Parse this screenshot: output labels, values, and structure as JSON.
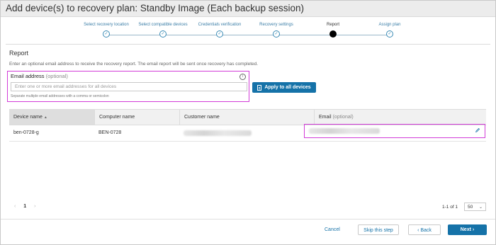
{
  "window": {
    "title": "Add device(s) to recovery plan: Standby Image (Each backup session)"
  },
  "stepper": {
    "steps": [
      {
        "label": "Select recovery location",
        "state": "done"
      },
      {
        "label": "Select compatible devices",
        "state": "done"
      },
      {
        "label": "Credentials verification",
        "state": "done"
      },
      {
        "label": "Recovery settings",
        "state": "done"
      },
      {
        "label": "Report",
        "state": "current"
      },
      {
        "label": "Assign plan",
        "state": "pending"
      }
    ]
  },
  "report": {
    "heading": "Report",
    "description": "Enter an optional email address to receive the recovery report. The email report will be sent once recovery has completed.",
    "email_label": "Email address",
    "email_optional": "(optional)",
    "email_value": "",
    "email_placeholder": "Enter one or more email addresses for all devices",
    "email_hint": "Separate multiple email addresses with a comma or semicolon",
    "apply_label": "Apply to all devices"
  },
  "table": {
    "columns": {
      "device_name": "Device name",
      "computer_name": "Computer name",
      "customer_name": "Customer name",
      "email": "Email",
      "email_optional": "(optional)"
    },
    "rows": [
      {
        "device_name": "ben-0728-g",
        "computer_name": "BEN-0728"
      }
    ]
  },
  "pagination": {
    "prev": "‹",
    "page": "1",
    "next": "›",
    "range": "1-1 of 1",
    "per_page": "50"
  },
  "footer": {
    "cancel": "Cancel",
    "skip": "Skip this step",
    "back": "Back",
    "next": "Next"
  },
  "colors": {
    "accent": "#1572a8",
    "highlight": "#d23cd8"
  }
}
